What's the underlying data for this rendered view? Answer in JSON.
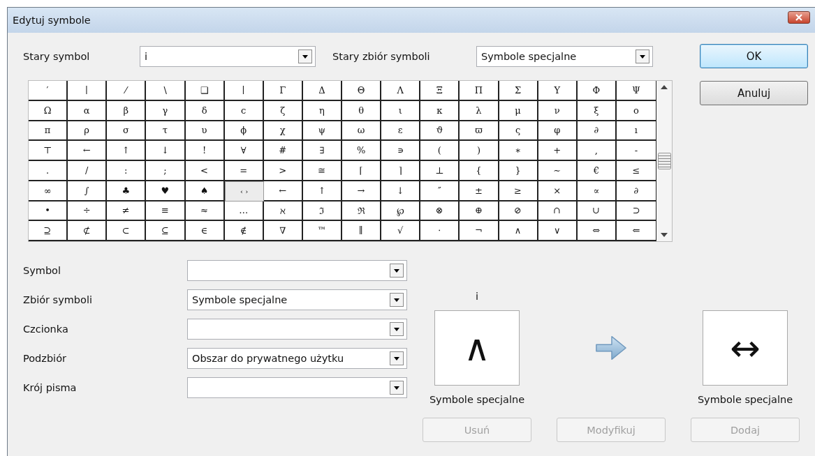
{
  "window": {
    "title": "Edytuj symbole"
  },
  "old_symbol": {
    "label": "Stary symbol",
    "value": "i"
  },
  "old_symbol_set": {
    "label": "Stary zbiór symboli",
    "value": "Symbole specjalne"
  },
  "dialog_buttons": [
    {
      "label": "OK",
      "default": true
    },
    {
      "label": "Anuluj",
      "default": false
    }
  ],
  "symbol_grid": [
    [
      {
        "symbol": "′",
        "selected": false
      },
      {
        "symbol": "∣",
        "selected": false
      },
      {
        "symbol": "⁄",
        "selected": false
      },
      {
        "symbol": "∖",
        "selected": false
      },
      {
        "symbol": "❑",
        "selected": false
      },
      {
        "symbol": "∣",
        "selected": false
      },
      {
        "symbol": "Γ",
        "selected": false
      },
      {
        "symbol": "Δ",
        "selected": false
      },
      {
        "symbol": "Θ",
        "selected": false
      },
      {
        "symbol": "Λ",
        "selected": false
      },
      {
        "symbol": "Ξ",
        "selected": false
      },
      {
        "symbol": "Π",
        "selected": false
      },
      {
        "symbol": "Σ",
        "selected": false
      },
      {
        "symbol": "Υ",
        "selected": false
      },
      {
        "symbol": "Φ",
        "selected": false
      },
      {
        "symbol": "Ψ",
        "selected": false
      }
    ],
    [
      {
        "symbol": "Ω",
        "selected": false
      },
      {
        "symbol": "α",
        "selected": false
      },
      {
        "symbol": "β",
        "selected": false
      },
      {
        "symbol": "γ",
        "selected": false
      },
      {
        "symbol": "δ",
        "selected": false
      },
      {
        "symbol": "ϲ",
        "selected": false
      },
      {
        "symbol": "ζ",
        "selected": false
      },
      {
        "symbol": "η",
        "selected": false
      },
      {
        "symbol": "θ",
        "selected": false
      },
      {
        "symbol": "ι",
        "selected": false
      },
      {
        "symbol": "κ",
        "selected": false
      },
      {
        "symbol": "λ",
        "selected": false
      },
      {
        "symbol": "μ",
        "selected": false
      },
      {
        "symbol": "ν",
        "selected": false
      },
      {
        "symbol": "ξ",
        "selected": false
      },
      {
        "symbol": "ο",
        "selected": false
      }
    ],
    [
      {
        "symbol": "π",
        "selected": false
      },
      {
        "symbol": "ρ",
        "selected": false
      },
      {
        "symbol": "σ",
        "selected": false
      },
      {
        "symbol": "τ",
        "selected": false
      },
      {
        "symbol": "υ",
        "selected": false
      },
      {
        "symbol": "ϕ",
        "selected": false
      },
      {
        "symbol": "χ",
        "selected": false
      },
      {
        "symbol": "ψ",
        "selected": false
      },
      {
        "symbol": "ω",
        "selected": false
      },
      {
        "symbol": "ε",
        "selected": false
      },
      {
        "symbol": "ϑ",
        "selected": false
      },
      {
        "symbol": "ϖ",
        "selected": false
      },
      {
        "symbol": "ς",
        "selected": false
      },
      {
        "symbol": "φ",
        "selected": false
      },
      {
        "symbol": "∂",
        "selected": false
      },
      {
        "symbol": "ı",
        "selected": false
      }
    ],
    [
      {
        "symbol": "⊤",
        "selected": false
      },
      {
        "symbol": "←",
        "selected": false
      },
      {
        "symbol": "↑",
        "selected": false
      },
      {
        "symbol": "↓",
        "selected": false
      },
      {
        "symbol": "!",
        "selected": false
      },
      {
        "symbol": "∀",
        "selected": false
      },
      {
        "symbol": "#",
        "selected": false
      },
      {
        "symbol": "∃",
        "selected": false
      },
      {
        "symbol": "%",
        "selected": false
      },
      {
        "symbol": "∍",
        "selected": false
      },
      {
        "symbol": "(",
        "selected": false
      },
      {
        "symbol": ")",
        "selected": false
      },
      {
        "symbol": "∗",
        "selected": false
      },
      {
        "symbol": "+",
        "selected": false
      },
      {
        "symbol": ",",
        "selected": false
      },
      {
        "symbol": "-",
        "selected": false
      }
    ],
    [
      {
        "symbol": ".",
        "selected": false
      },
      {
        "symbol": "/",
        "selected": false
      },
      {
        "symbol": ":",
        "selected": false
      },
      {
        "symbol": ";",
        "selected": false
      },
      {
        "symbol": "<",
        "selected": false
      },
      {
        "symbol": "=",
        "selected": false
      },
      {
        "symbol": ">",
        "selected": false
      },
      {
        "symbol": "≅",
        "selected": false
      },
      {
        "symbol": "⌈",
        "selected": false
      },
      {
        "symbol": "⌉",
        "selected": false
      },
      {
        "symbol": "⊥",
        "selected": false
      },
      {
        "symbol": "{",
        "selected": false
      },
      {
        "symbol": "}",
        "selected": false
      },
      {
        "symbol": "∼",
        "selected": false
      },
      {
        "symbol": "€",
        "selected": false
      },
      {
        "symbol": "≤",
        "selected": false
      }
    ],
    [
      {
        "symbol": "∞",
        "selected": false
      },
      {
        "symbol": "∫",
        "selected": false
      },
      {
        "symbol": "♣",
        "selected": false
      },
      {
        "symbol": "♥",
        "selected": false
      },
      {
        "symbol": "♠",
        "selected": false
      },
      {
        "symbol": "‹ ›",
        "selected": true
      },
      {
        "symbol": "←",
        "selected": false
      },
      {
        "symbol": "↑",
        "selected": false
      },
      {
        "symbol": "→",
        "selected": false
      },
      {
        "symbol": "↓",
        "selected": false
      },
      {
        "symbol": "″",
        "selected": false
      },
      {
        "symbol": "±",
        "selected": false
      },
      {
        "symbol": "≥",
        "selected": false
      },
      {
        "symbol": "×",
        "selected": false
      },
      {
        "symbol": "∝",
        "selected": false
      },
      {
        "symbol": "∂",
        "selected": false
      }
    ],
    [
      {
        "symbol": "•",
        "selected": false
      },
      {
        "symbol": "÷",
        "selected": false
      },
      {
        "symbol": "≠",
        "selected": false
      },
      {
        "symbol": "≡",
        "selected": false
      },
      {
        "symbol": "≈",
        "selected": false
      },
      {
        "symbol": "…",
        "selected": false
      },
      {
        "symbol": "ℵ",
        "selected": false
      },
      {
        "symbol": "ℑ",
        "selected": false
      },
      {
        "symbol": "ℜ",
        "selected": false
      },
      {
        "symbol": "℘",
        "selected": false
      },
      {
        "symbol": "⊗",
        "selected": false
      },
      {
        "symbol": "⊕",
        "selected": false
      },
      {
        "symbol": "⊘",
        "selected": false
      },
      {
        "symbol": "∩",
        "selected": false
      },
      {
        "symbol": "∪",
        "selected": false
      },
      {
        "symbol": "⊃",
        "selected": false
      }
    ],
    [
      {
        "symbol": "⊇",
        "selected": false
      },
      {
        "symbol": "⊄",
        "selected": false
      },
      {
        "symbol": "⊂",
        "selected": false
      },
      {
        "symbol": "⊆",
        "selected": false
      },
      {
        "symbol": "∈",
        "selected": false
      },
      {
        "symbol": "∉",
        "selected": false
      },
      {
        "symbol": "∇",
        "selected": false
      },
      {
        "symbol": "™",
        "selected": false
      },
      {
        "symbol": "∥",
        "selected": false
      },
      {
        "symbol": "√",
        "selected": false
      },
      {
        "symbol": "⋅",
        "selected": false
      },
      {
        "symbol": "¬",
        "selected": false
      },
      {
        "symbol": "∧",
        "selected": false
      },
      {
        "symbol": "∨",
        "selected": false
      },
      {
        "symbol": "⇔",
        "selected": false
      },
      {
        "symbol": "⇐",
        "selected": false
      }
    ]
  ],
  "fields": [
    {
      "label": "Symbol"
    },
    {
      "label": "Zbiór symboli",
      "value": "Symbole specjalne"
    },
    {
      "label": "Czcionka"
    },
    {
      "label": "Podzbiór",
      "value": "Obszar do prywatnego użytku"
    },
    {
      "label": "Krój pisma"
    }
  ],
  "preview": {
    "old": {
      "name": "i",
      "symbol": "∧",
      "set": "Symbole specjalne"
    },
    "new": {
      "symbol": "↔",
      "set": "Symbole specjalne"
    }
  },
  "action_buttons": [
    {
      "label": "Usuń",
      "disabled": true
    },
    {
      "label": "Modyfikuj",
      "disabled": true
    },
    {
      "label": "Dodaj",
      "disabled": true
    }
  ]
}
